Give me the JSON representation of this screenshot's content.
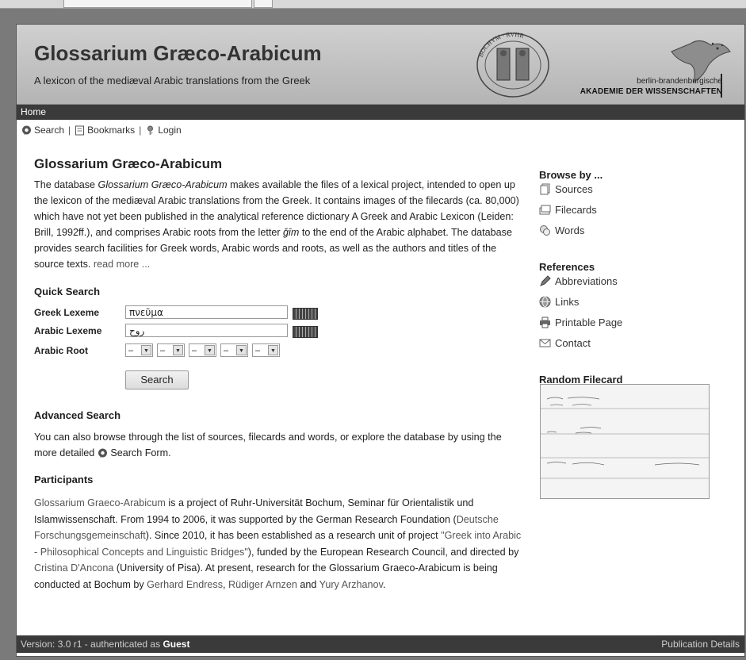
{
  "header": {
    "title": "Glossarium Græco-Arabicum",
    "subtitle": "A lexicon of the mediæval Arabic translations from the Greek",
    "seal_text": "BOCHVM · RVHR-VNIVERSITAT",
    "bbaw_line1": "berlin-brandenburgische",
    "bbaw_line2": "AKADEMIE DER WISSENSCHAFTEN"
  },
  "navbar": {
    "home": "Home"
  },
  "toolbar": {
    "search": "Search",
    "bookmarks": "Bookmarks",
    "login": "Login",
    "sep": "|"
  },
  "intro": {
    "title": "Glossarium Græco-Arabicum",
    "p1_a": "The database ",
    "p1_em": "Glossarium Græco-Arabicum",
    "p1_b": " makes available the files of a lexical project, intended to open up the lexicon of the mediæval Arabic translations from the Greek. It contains images of the filecards (ca. 80,000) which have not yet been published in the analytical reference dictionary A Greek and Arabic Lexicon (Leiden: Brill, 1992ff.), and comprises Arabic roots from the letter ",
    "p1_em2": "ǧīm",
    "p1_c": " to the end of the Arabic alphabet. The database provides search facilities for Greek words, Arabic words and roots, as well as the authors and titles of the source texts. ",
    "read_more": "read more ..."
  },
  "quick_search": {
    "title": "Quick Search",
    "greek_label": "Greek Lexeme",
    "greek_value": "πνεῦμα",
    "arabic_label": "Arabic Lexeme",
    "arabic_value": "روح",
    "root_label": "Arabic Root",
    "root_values": [
      "–",
      "–",
      "–",
      "–",
      "–"
    ],
    "button": "Search"
  },
  "advanced": {
    "title": "Advanced Search",
    "text_a": "You can also browse through the list of sources, filecards and words, or explore the database by using the more detailed ",
    "link": "Search Form",
    "text_b": "."
  },
  "participants": {
    "title": "Participants",
    "l1": "Glossarium Graeco-Arabicum",
    "t1": " is a project of Ruhr-Universität Bochum, Seminar für Orientalistik und Islamwissenschaft. From 1994 to 2006, it was supported by the German Research Foundation (",
    "l2": "Deutsche Forschungsgemeinschaft",
    "t2": "). Since 2010, it has been established as a research unit of project ",
    "l3": "\"Greek into Arabic - Philosophical Concepts and Linguistic Bridges\"",
    "t3": "), funded by the European Research Council, and directed by ",
    "l4": "Cristina D'Ancona",
    "t4": " (University of Pisa). At present, research for the Glossarium Graeco-Arabicum is being conducted at Bochum by ",
    "l5": "Gerhard Endress",
    "t5": ", ",
    "l6": "Rüdiger Arnzen",
    "t6": " and ",
    "l7": "Yury Arzhanov",
    "t7": "."
  },
  "sidebar": {
    "browse_title": "Browse by ...",
    "sources": "Sources",
    "filecards": "Filecards",
    "words": "Words",
    "references_title": "References",
    "abbreviations": "Abbreviations",
    "links": "Links",
    "printable": "Printable Page",
    "contact": "Contact",
    "random_title": "Random Filecard"
  },
  "footer": {
    "version": "Version: 3.0 r1 - authenticated as ",
    "user": "Guest",
    "publication": "Publication Details"
  }
}
